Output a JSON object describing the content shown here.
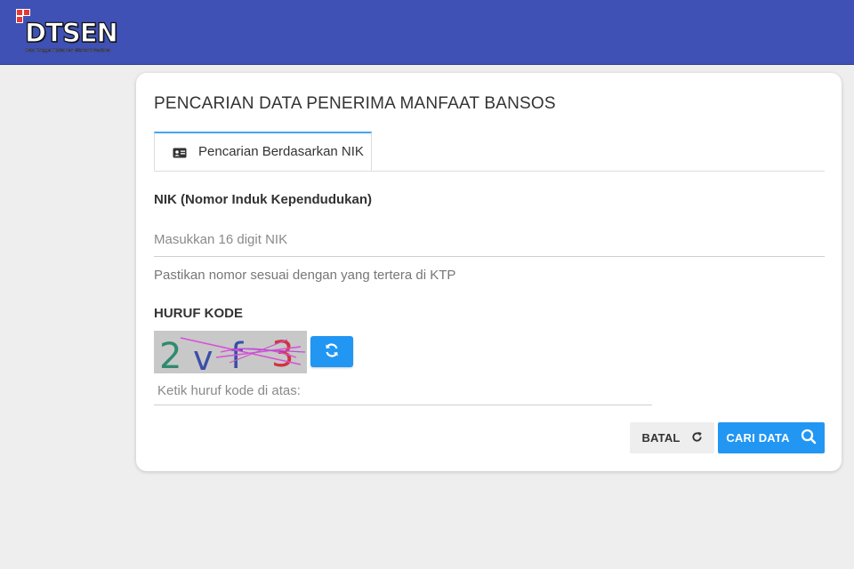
{
  "header": {
    "logo_text": "DTSEN",
    "logo_subtitle": "Data Tunggal Sosial dan Ekonomi Nasional",
    "brand_color": "#3f51b5"
  },
  "card": {
    "title": "PENCARIAN DATA PENERIMA MANFAAT BANSOS",
    "tabs": [
      {
        "label": "Pencarian Berdasarkan NIK",
        "icon": "id-card-icon",
        "active": true
      }
    ]
  },
  "nik": {
    "label": "NIK (Nomor Induk Kependudukan)",
    "placeholder": "Masukkan 16 digit NIK",
    "value": "",
    "hint": "Pastikan nomor sesuai dengan yang tertera di KTP"
  },
  "captcha": {
    "label": "HURUF KODE",
    "characters": [
      "2",
      "v",
      "f",
      "3"
    ],
    "placeholder": "Ketik huruf kode di atas:",
    "value": "",
    "refresh_icon": "refresh-icon"
  },
  "actions": {
    "cancel_label": "BATAL",
    "cancel_icon": "reload-icon",
    "search_label": "CARI DATA",
    "search_icon": "search-icon",
    "accent_color": "#2196f3"
  }
}
